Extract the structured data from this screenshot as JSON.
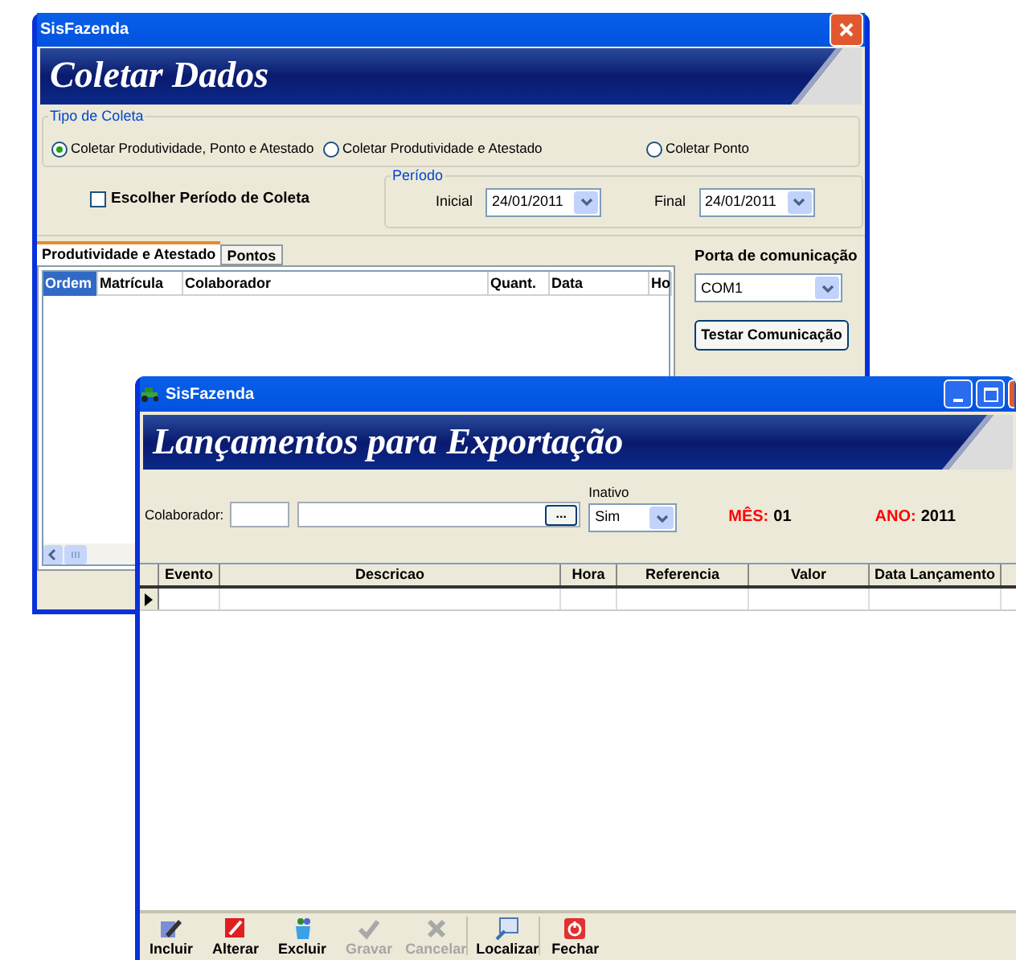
{
  "back_window": {
    "title": "SisFazenda",
    "header": "Coletar Dados",
    "tipo_de_coleta": {
      "legend": "Tipo de Coleta",
      "options": [
        {
          "label": "Coletar Produtividade, Ponto e Atestado",
          "selected": true
        },
        {
          "label": "Coletar Produtividade e Atestado",
          "selected": false
        },
        {
          "label": "Coletar Ponto",
          "selected": false
        }
      ]
    },
    "periodo_checkbox": {
      "label": "Escolher Período de Coleta",
      "checked": false
    },
    "periodo": {
      "legend": "Período",
      "initial_label": "Inicial",
      "initial": "24/01/2011",
      "final_label": "Final",
      "final": "24/01/2011"
    },
    "tabs": [
      {
        "label": "Produtividade e Atestado",
        "selected": true
      },
      {
        "label": "Pontos",
        "selected": false
      }
    ],
    "columns": [
      {
        "label": "Ordem",
        "selected": true
      },
      {
        "label": "Matrícula",
        "selected": false
      },
      {
        "label": "Colaborador",
        "selected": false
      },
      {
        "label": "Quant.",
        "selected": false
      },
      {
        "label": "Data",
        "selected": false
      },
      {
        "label": "Ho",
        "selected": false
      }
    ],
    "port": {
      "label": "Porta de comunicação",
      "value": "COM1"
    },
    "test_button": "Testar Comunicação"
  },
  "front_window": {
    "title": "SisFazenda",
    "header": "Lançamentos para Exportação",
    "filter": {
      "colaborador_label": "Colaborador:",
      "lookup_button": "...",
      "inativo_label": "Inativo",
      "inativo": "Sim",
      "month_label": "MÊS:",
      "month": "01",
      "year_label": "ANO:",
      "year": "2011"
    },
    "columns": [
      "Evento",
      "Descricao",
      "Hora",
      "Referencia",
      "Valor",
      "Data Lançamento"
    ],
    "toolbar": [
      {
        "kind": "add",
        "label": "Incluir",
        "disabled": false
      },
      {
        "kind": "edit",
        "label": "Alterar",
        "disabled": false
      },
      {
        "kind": "delete",
        "label": "Excluir",
        "disabled": false
      },
      {
        "kind": "save",
        "label": "Gravar",
        "disabled": true
      },
      {
        "kind": "cancel",
        "label": "Cancelar",
        "disabled": true
      },
      {
        "kind": "find",
        "label": "Localizar",
        "disabled": false
      },
      {
        "kind": "close",
        "label": "Fechar",
        "disabled": false
      }
    ]
  }
}
